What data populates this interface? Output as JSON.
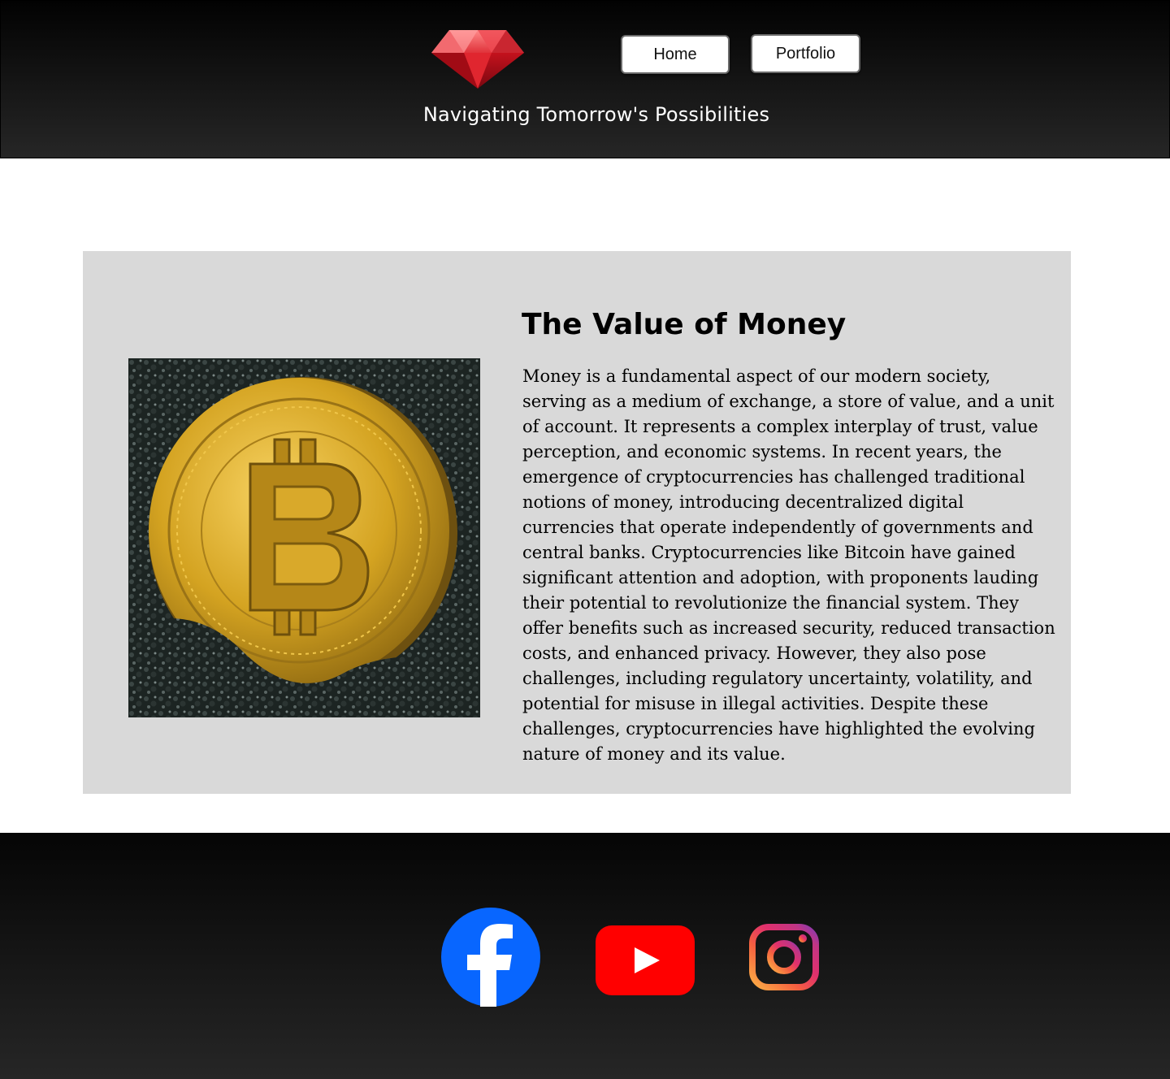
{
  "header": {
    "logo_icon": "ruby-gem-icon",
    "nav": {
      "home_label": "Home",
      "portfolio_label": "Portfolio"
    },
    "tagline": "Navigating Tomorrow's Possibilities"
  },
  "article": {
    "image_icon": "bitcoin-coin-image",
    "title": "The Value of Money",
    "body": "Money is a fundamental aspect of our modern society, serving as a medium of exchange, a store of value, and a unit of account. It represents a complex interplay of trust, value perception, and economic systems. In recent years, the emergence of cryptocurrencies has challenged traditional notions of money, introducing decentralized digital currencies that operate independently of governments and central banks. Cryptocurrencies like Bitcoin have gained significant attention and adoption, with proponents lauding their potential to revolutionize the financial system. They offer benefits such as increased security, reduced transaction costs, and enhanced privacy. However, they also pose challenges, including regulatory uncertainty, volatility, and potential for misuse in illegal activities. Despite these challenges, cryptocurrencies have highlighted the evolving nature of money and its value."
  },
  "footer": {
    "social": [
      {
        "icon": "facebook-icon",
        "color": "#0866ff"
      },
      {
        "icon": "youtube-icon",
        "color": "#ff0000"
      },
      {
        "icon": "instagram-icon",
        "color": "#e1306c"
      }
    ]
  },
  "colors": {
    "header_bg_top": "#020202",
    "header_bg_bottom": "#262626",
    "card_bg": "#d9d9d9",
    "ruby": "#d11f2c",
    "coin_gold": "#d4a321"
  }
}
